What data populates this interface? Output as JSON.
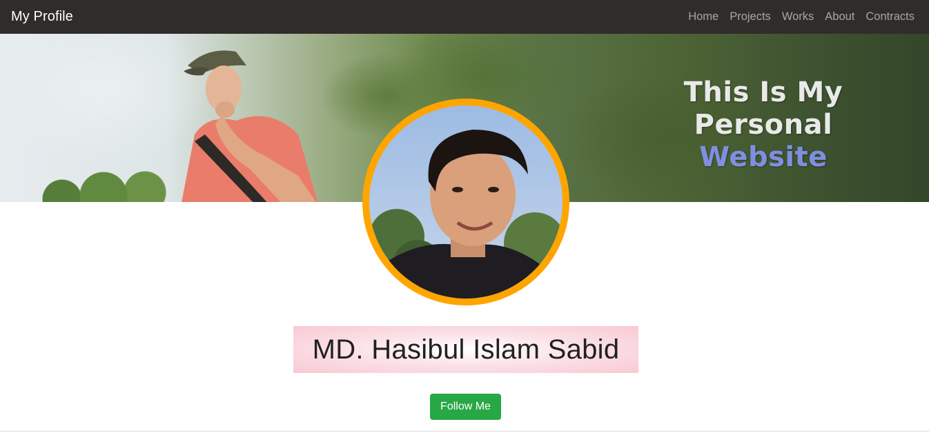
{
  "navbar": {
    "brand": "My Profile",
    "links": [
      "Home",
      "Projects",
      "Works",
      "About",
      "Contracts"
    ]
  },
  "cover": {
    "title_line1": "This Is My Personal",
    "title_line2": "Website"
  },
  "profile": {
    "name": "MD. Hasibul Islam Sabid",
    "follow_label": "Follow Me"
  },
  "colors": {
    "navbar_bg": "#302c2b",
    "avatar_border": "#ffa500",
    "follow_button": "#28a745",
    "title_accent": "#7f8fe0"
  }
}
